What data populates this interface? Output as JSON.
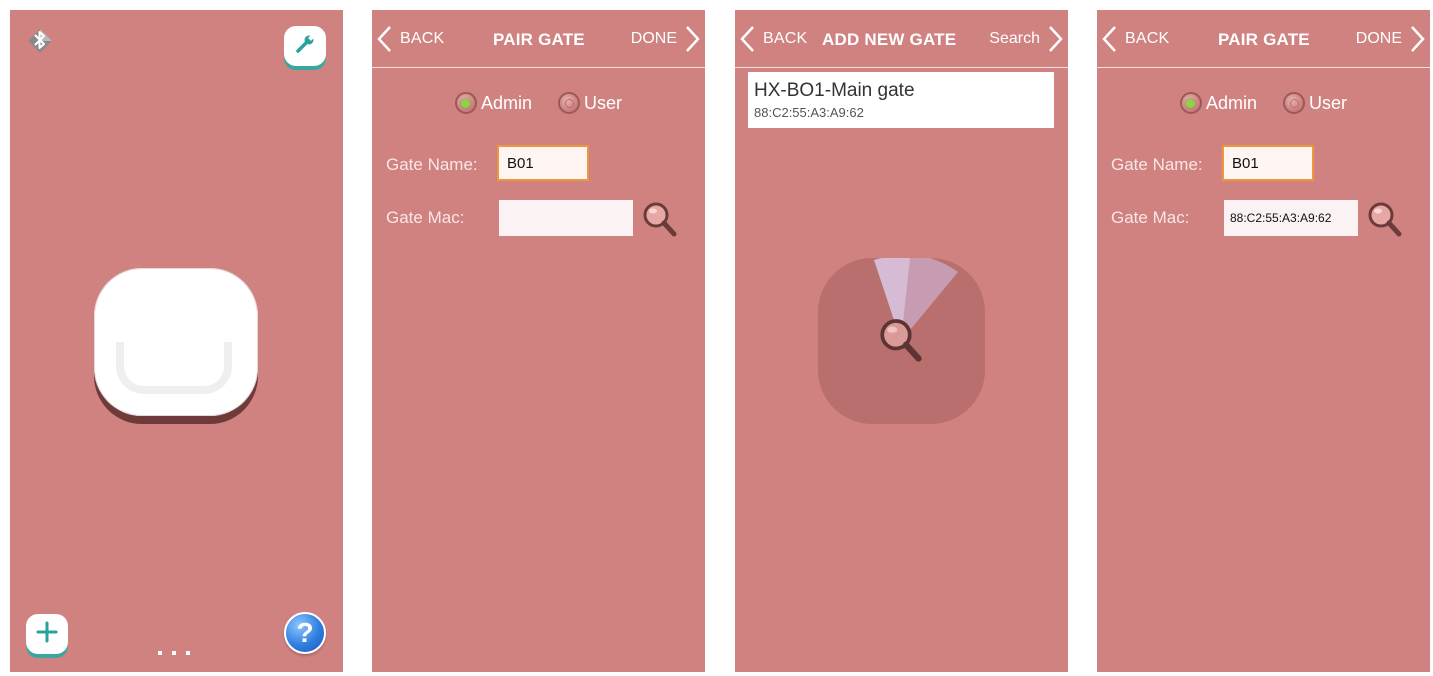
{
  "screen1": {
    "icons": {
      "bluetooth": "bluetooth-icon",
      "settings": "wrench-icon",
      "add": "plus-icon",
      "help": "question-icon"
    },
    "help_glyph": "?",
    "page_dots": 3
  },
  "pair_gate_empty": {
    "back_label": "BACK",
    "title": "PAIR GATE",
    "done_label": "DONE",
    "radio_admin": "Admin",
    "radio_user": "User",
    "selected_role": "Admin",
    "gate_name_label": "Gate Name:",
    "gate_name_value": "B01",
    "gate_mac_label": "Gate Mac:",
    "gate_mac_value": ""
  },
  "add_new_gate": {
    "back_label": "BACK",
    "title": "ADD NEW GATE",
    "search_label": "Search",
    "results": [
      {
        "name": "HX-BO1-Main gate",
        "mac": "88:C2:55:A3:A9:62"
      }
    ]
  },
  "pair_gate_filled": {
    "back_label": "BACK",
    "title": "PAIR GATE",
    "done_label": "DONE",
    "radio_admin": "Admin",
    "radio_user": "User",
    "selected_role": "Admin",
    "gate_name_label": "Gate Name:",
    "gate_name_value": "B01",
    "gate_mac_label": "Gate Mac:",
    "gate_mac_value": "88:C2:55:A3:A9:62"
  },
  "colors": {
    "screen_bg": "#d08280",
    "accent_teal": "#3aa6a0",
    "focus_orange": "#f0963c",
    "radio_green": "#8fd24a"
  }
}
